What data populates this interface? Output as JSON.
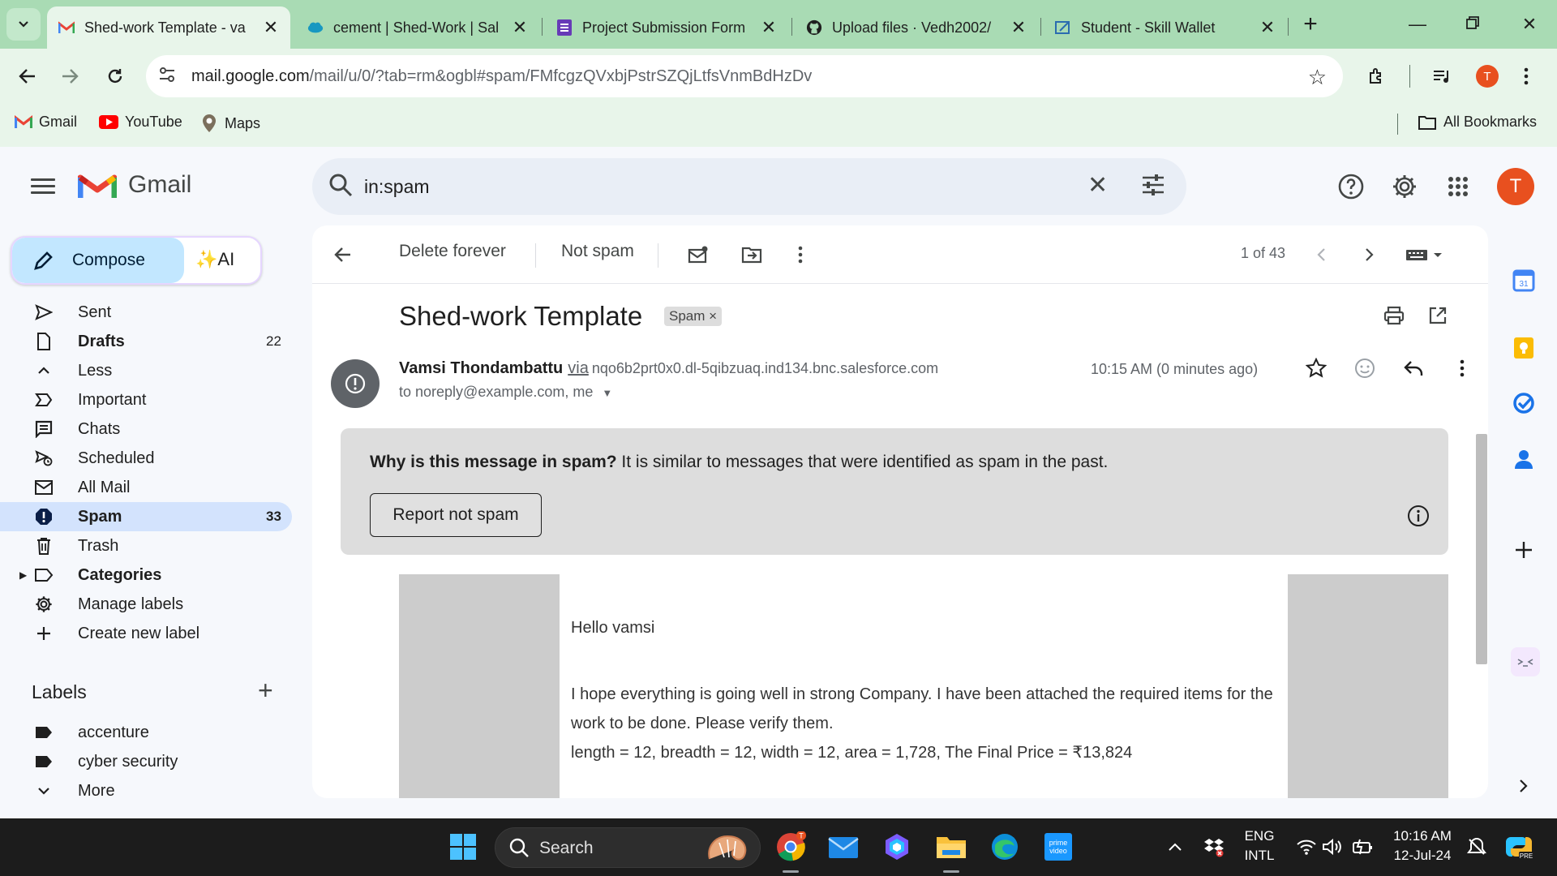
{
  "tabs": [
    {
      "title": "Shed-work Template - va",
      "active": true,
      "icon": "gmail-icon"
    },
    {
      "title": "cement | Shed-Work | Sal",
      "active": false,
      "icon": "salesforce-cloud-icon"
    },
    {
      "title": "Project Submission Form",
      "active": false,
      "icon": "forms-icon"
    },
    {
      "title": "Upload files · Vedh2002/",
      "active": false,
      "icon": "github-icon"
    },
    {
      "title": "Student - Skill Wallet",
      "active": false,
      "icon": "skill-wallet-icon"
    }
  ],
  "url": {
    "host": "mail.google.com",
    "path": "/mail/u/0/?tab=rm&ogbl#spam/FMfcgzQVxbjPstrSZQjLtfsVnmBdHzDv"
  },
  "browser_profile_initial": "T",
  "bookmarks": [
    {
      "label": "Gmail",
      "icon": "gmail-icon"
    },
    {
      "label": "YouTube",
      "icon": "youtube-icon"
    },
    {
      "label": "Maps",
      "icon": "maps-icon"
    }
  ],
  "all_bookmarks_label": "All Bookmarks",
  "gmail": {
    "wordmark": "Gmail",
    "search_query": "in:spam",
    "avatar_initial": "T",
    "compose_label": "Compose",
    "ai_label": "✨AI",
    "nav": [
      {
        "label": "Sent",
        "icon": "sent-icon",
        "count": "",
        "bold": false,
        "active": false
      },
      {
        "label": "Drafts",
        "icon": "drafts-icon",
        "count": "22",
        "bold": true,
        "active": false
      },
      {
        "label": "Less",
        "icon": "chevron-up-icon",
        "count": "",
        "bold": false,
        "active": false
      },
      {
        "label": "Important",
        "icon": "important-icon",
        "count": "",
        "bold": false,
        "active": false
      },
      {
        "label": "Chats",
        "icon": "chats-icon",
        "count": "",
        "bold": false,
        "active": false
      },
      {
        "label": "Scheduled",
        "icon": "scheduled-icon",
        "count": "",
        "bold": false,
        "active": false
      },
      {
        "label": "All Mail",
        "icon": "all-mail-icon",
        "count": "",
        "bold": false,
        "active": false
      },
      {
        "label": "Spam",
        "icon": "spam-icon",
        "count": "33",
        "bold": true,
        "active": true
      },
      {
        "label": "Trash",
        "icon": "trash-icon",
        "count": "",
        "bold": false,
        "active": false
      },
      {
        "label": "Categories",
        "icon": "label-icon",
        "count": "",
        "bold": true,
        "active": false
      },
      {
        "label": "Manage labels",
        "icon": "gear-icon",
        "count": "",
        "bold": false,
        "active": false
      },
      {
        "label": "Create new label",
        "icon": "plus-icon",
        "count": "",
        "bold": false,
        "active": false
      }
    ],
    "labels_header": "Labels",
    "labels": [
      {
        "label": "accenture",
        "icon": "label-icon"
      },
      {
        "label": "cyber security",
        "icon": "label-icon"
      },
      {
        "label": "More",
        "icon": "chevron-down-icon"
      }
    ],
    "toolbar": {
      "delete_forever": "Delete forever",
      "not_spam": "Not spam",
      "pager": "1 of 43"
    },
    "message": {
      "subject": "Shed-work Template",
      "chip": "Spam",
      "sender_name": "Vamsi Thondambattu",
      "via": "via",
      "via_domain": "nqo6b2prt0x0.dl-5qibzuaq.ind134.bnc.salesforce.com",
      "recipients": "to noreply@example.com, me",
      "time": "10:15 AM (0 minutes ago)",
      "spam_question": "Why is this message in spam?",
      "spam_reason": " It is similar to messages that were identified as spam in the past.",
      "report_not_spam": "Report not spam",
      "body": [
        "Hello vamsi",
        "I hope everything is going well in strong Company. I have been attached the required items for the work to be done. Please verify them.",
        "length = 12, breadth = 12, width = 12, area = 1,728, The Final Price = ₹13,824"
      ]
    }
  },
  "taskbar": {
    "search_label": "Search",
    "lang_top": "ENG",
    "lang_bottom": "INTL",
    "time": "10:16 AM",
    "date": "12-Jul-24"
  }
}
